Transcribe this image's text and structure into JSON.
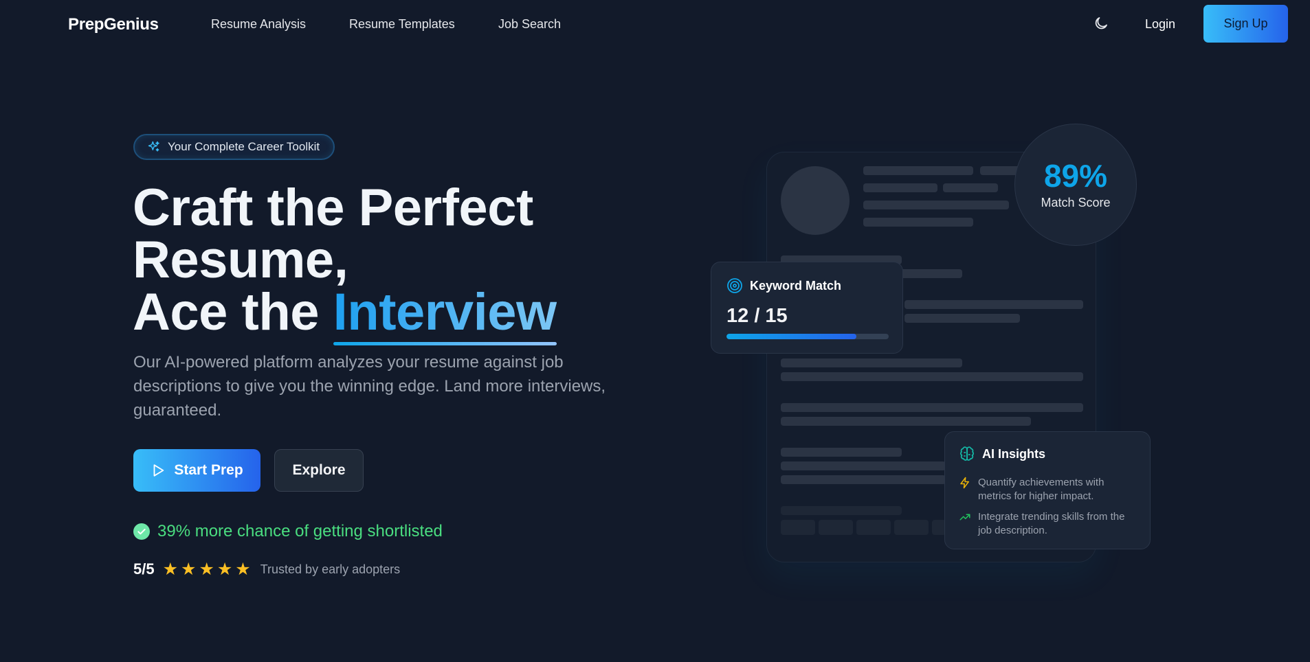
{
  "nav": {
    "brand": "PrepGenius",
    "links": [
      "Resume Analysis",
      "Resume Templates",
      "Job Search"
    ],
    "theme_icon": "moon-icon",
    "login": "Login",
    "signup": "Sign Up"
  },
  "hero": {
    "badge": "Your Complete Career Toolkit",
    "headline_line1": "Craft the Perfect",
    "headline_line2": "Resume,",
    "headline_line3_prefix": "Ace the ",
    "headline_accent": "Interview",
    "subtitle": "Our AI-powered platform analyzes your resume against job descriptions to give you the winning edge. Land more interviews, guaranteed.",
    "start_button": "Start Prep",
    "explore_button": "Explore",
    "shortlist_text": "39% more chance of getting shortlisted",
    "rating_score": "5/5",
    "rating_stars": 5,
    "trusted_text": "Trusted by early adopters"
  },
  "preview": {
    "match_value": "89%",
    "match_label": "Match Score",
    "keyword_title": "Keyword Match",
    "keyword_value": "12 / 15",
    "keyword_fraction": 0.8,
    "ai_title": "AI Insights",
    "ai_tips": [
      "Quantify achievements with metrics for higher impact.",
      "Integrate trending skills from the job description."
    ]
  },
  "colors": {
    "background": "#121a2a",
    "accent": "#0ea5e9",
    "success": "#4ade80",
    "star": "#fbbf24"
  }
}
